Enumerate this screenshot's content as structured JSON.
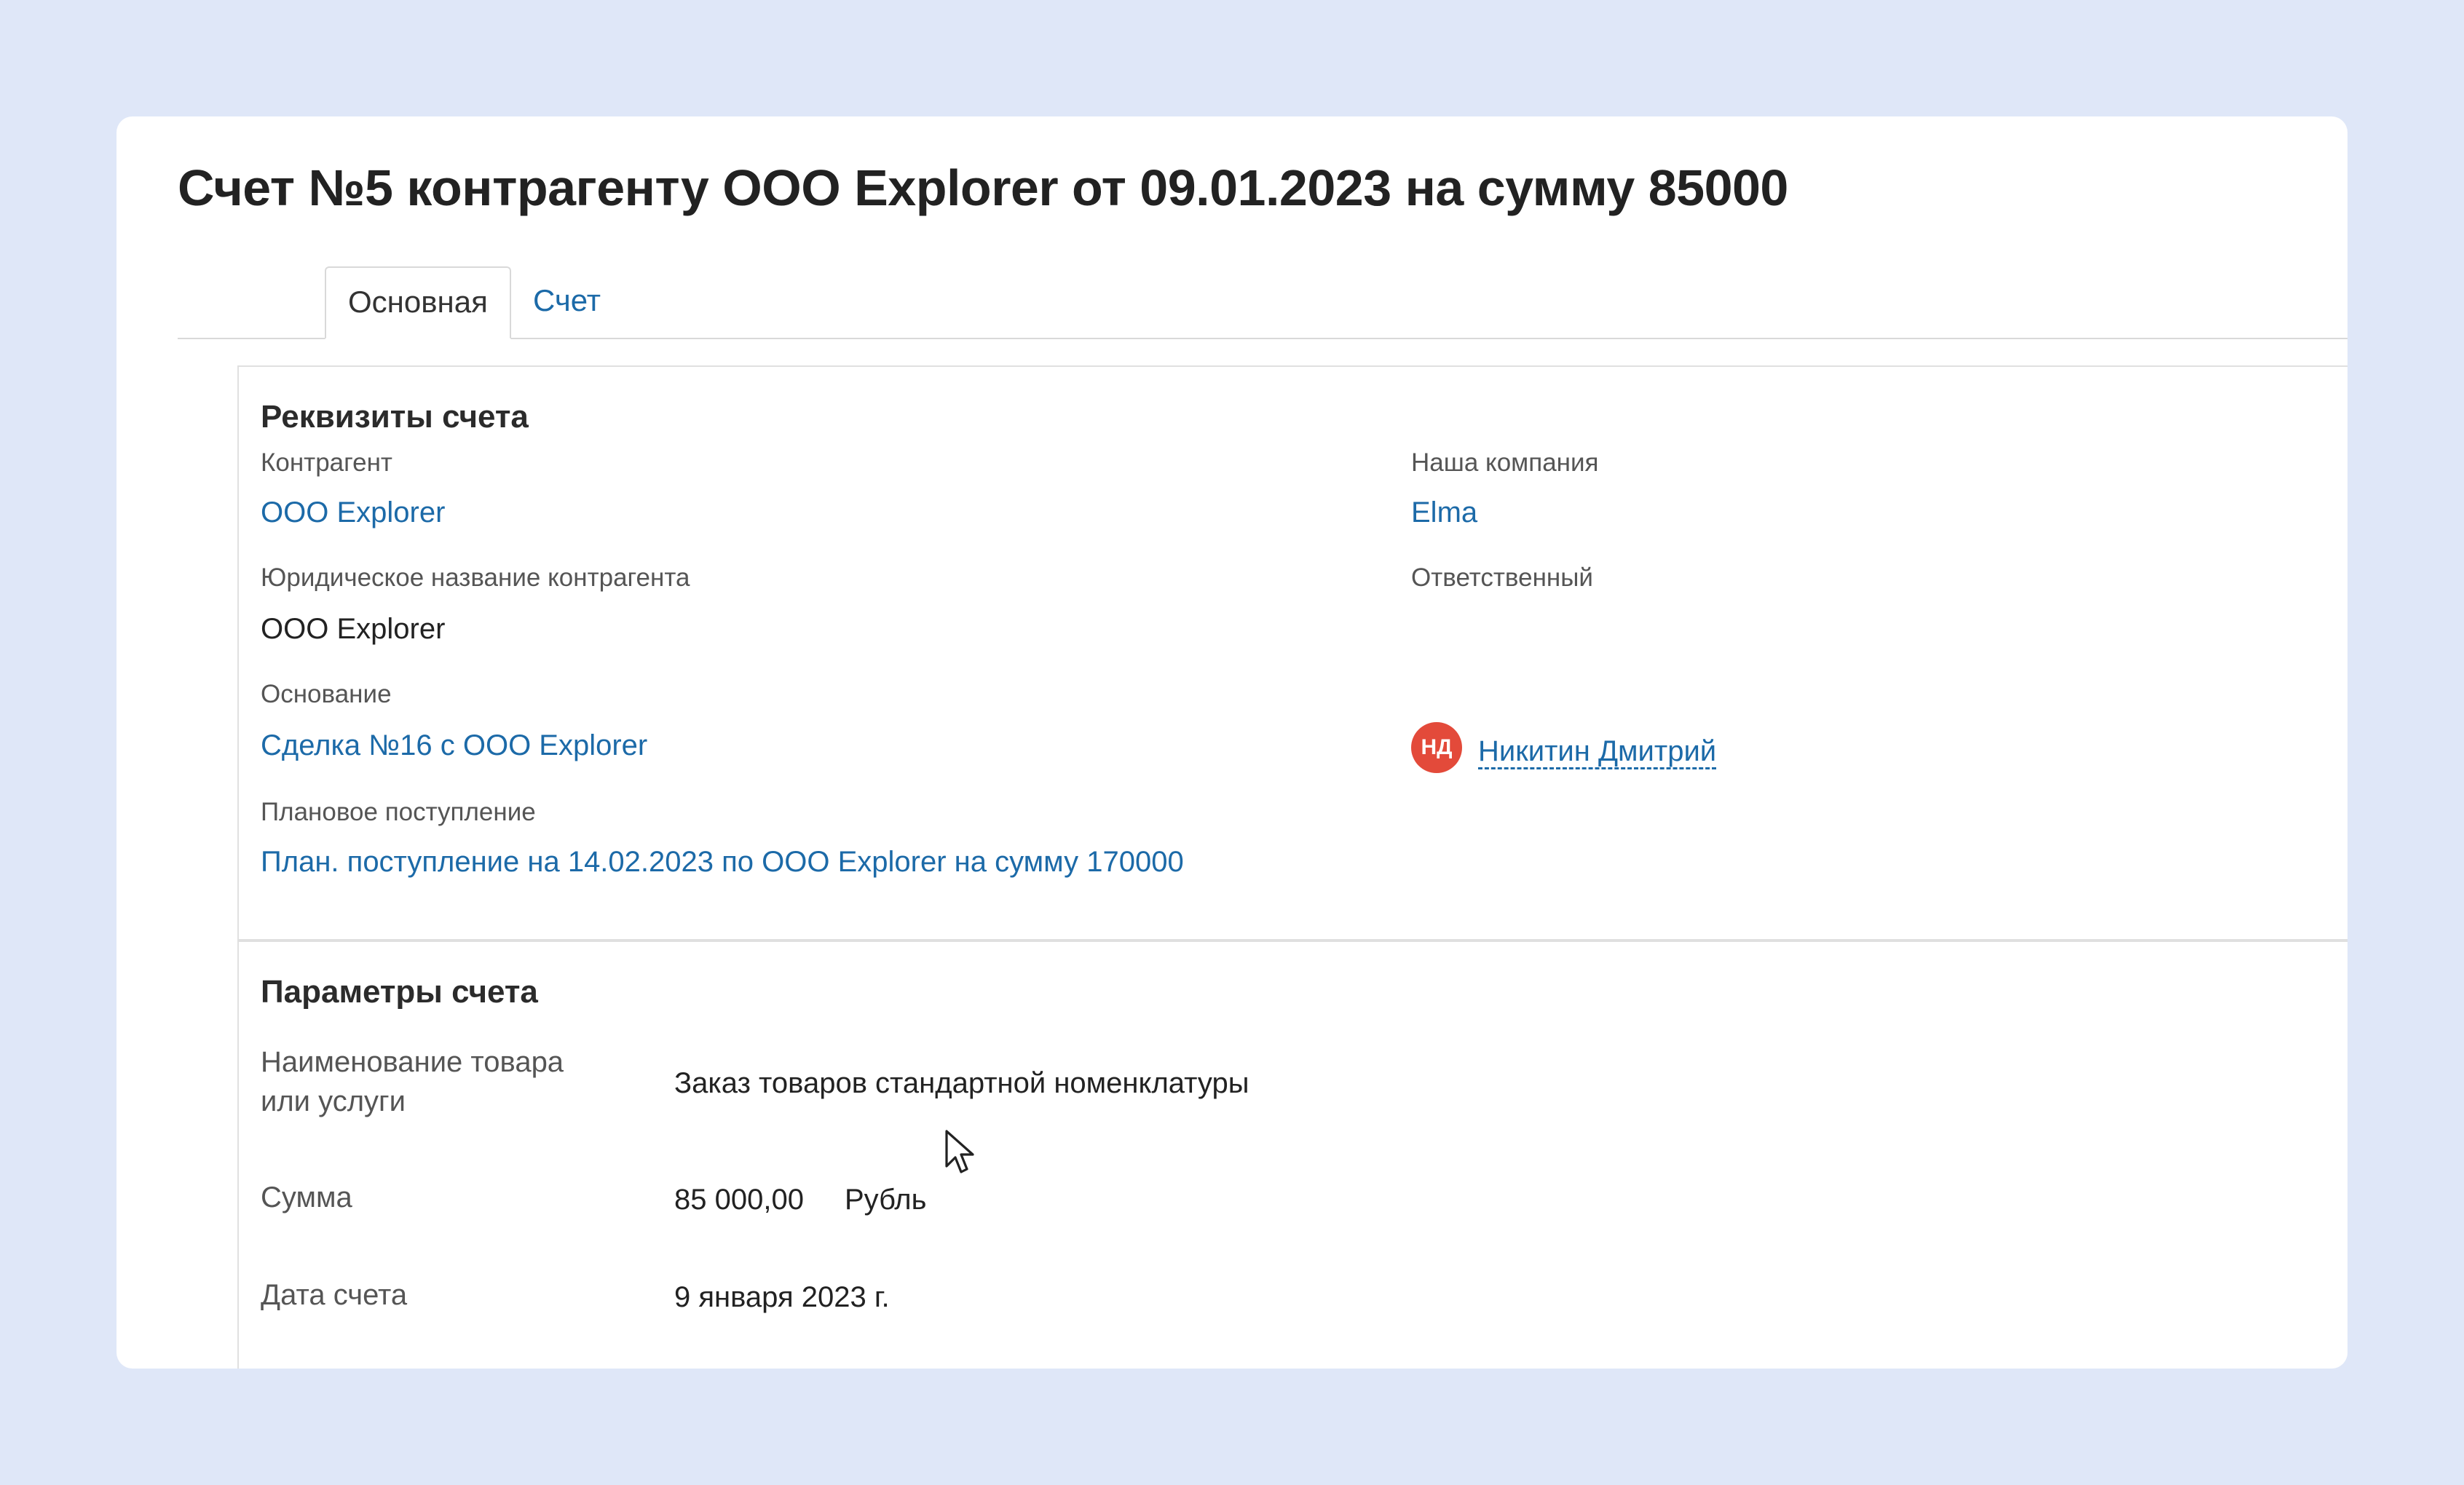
{
  "page": {
    "title": "Счет №5 контрагенту ООО Explorer от 09.01.2023 на сумму 85000"
  },
  "tabs": [
    {
      "label": "Основная",
      "active": true
    },
    {
      "label": "Счет",
      "active": false
    }
  ],
  "details": {
    "section_title": "Реквизиты счета",
    "counterparty_label": "Контрагент",
    "counterparty_value": "ООО Explorer",
    "legal_name_label": "Юридическое название контрагента",
    "legal_name_value": "ООО Explorer",
    "basis_label": "Основание",
    "basis_value": "Сделка №16 с ООО Explorer",
    "planned_label": "Плановое поступление",
    "planned_value": "План. поступление на 14.02.2023 по ООО Explorer на сумму 170000",
    "company_label": "Наша компания",
    "company_value": "Elma",
    "responsible_label": "Ответственный",
    "responsible_initials": "НД",
    "responsible_name": "Никитин Дмитрий"
  },
  "params": {
    "section_title": "Параметры счета",
    "product_label_line1": "Наименование товара",
    "product_label_line2": "или услуги",
    "product_value": "Заказ товаров стандартной номенклатуры",
    "sum_label": "Сумма",
    "sum_value": "85 000,00",
    "currency": "Рубль",
    "date_label": "Дата счета",
    "date_value": "9 января 2023 г."
  },
  "colors": {
    "link": "#1c6aa8",
    "avatar": "#e34a3a",
    "background": "#dfe7f8"
  }
}
